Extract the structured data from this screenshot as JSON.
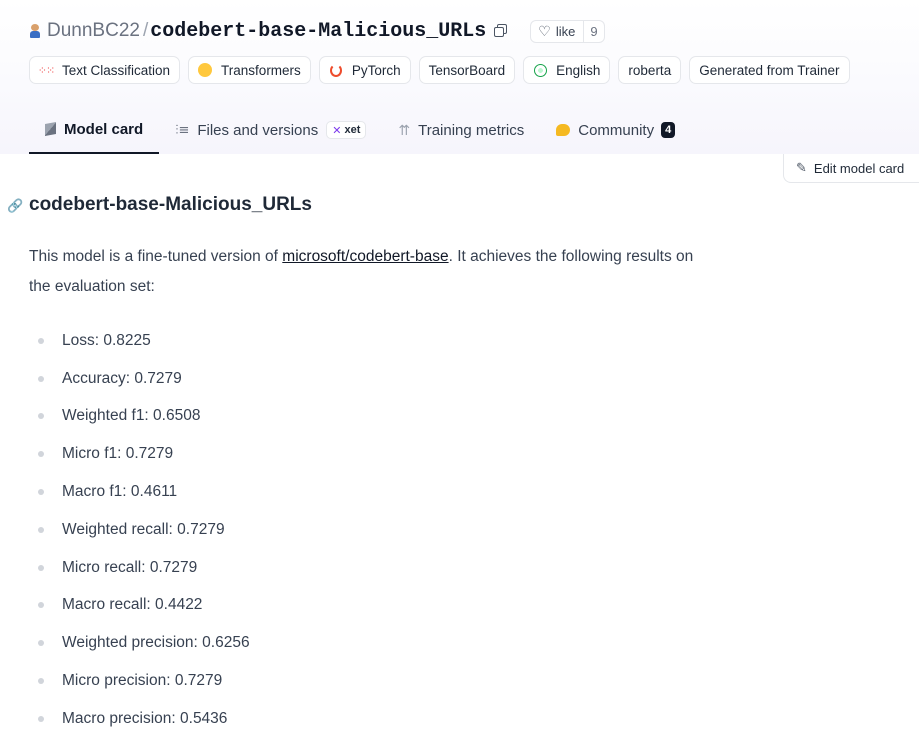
{
  "repo": {
    "owner": "DunnBC22",
    "separator": "/",
    "name": "codebert-base-Malicious_URLs",
    "like_label": "like",
    "like_count": "9"
  },
  "tags": [
    {
      "label": "Text Classification",
      "icon": "text-classification-icon"
    },
    {
      "label": "Transformers",
      "icon": "hugging-face-icon"
    },
    {
      "label": "PyTorch",
      "icon": "pytorch-icon"
    },
    {
      "label": "TensorBoard",
      "icon": ""
    },
    {
      "label": "English",
      "icon": "globe-icon"
    },
    {
      "label": "roberta",
      "icon": ""
    },
    {
      "label": "Generated from Trainer",
      "icon": ""
    }
  ],
  "tabs": [
    {
      "label": "Model card",
      "active": true
    },
    {
      "label": "Files and versions",
      "badge": "xet"
    },
    {
      "label": "Training metrics"
    },
    {
      "label": "Community",
      "count": "4"
    }
  ],
  "edit_button": "Edit model card",
  "card": {
    "title": "codebert-base-Malicious_URLs",
    "intro_before": "This model is a fine-tuned version of ",
    "intro_link": "microsoft/codebert-base",
    "intro_after": ". It achieves the following results on the evaluation set:",
    "metrics": [
      "Loss: 0.8225",
      "Accuracy: 0.7279",
      "Weighted f1: 0.6508",
      "Micro f1: 0.7279",
      "Macro f1: 0.4611",
      "Weighted recall: 0.7279",
      "Micro recall: 0.7279",
      "Macro recall: 0.4422",
      "Weighted precision: 0.6256",
      "Micro precision: 0.7279",
      "Macro precision: 0.5436"
    ]
  }
}
